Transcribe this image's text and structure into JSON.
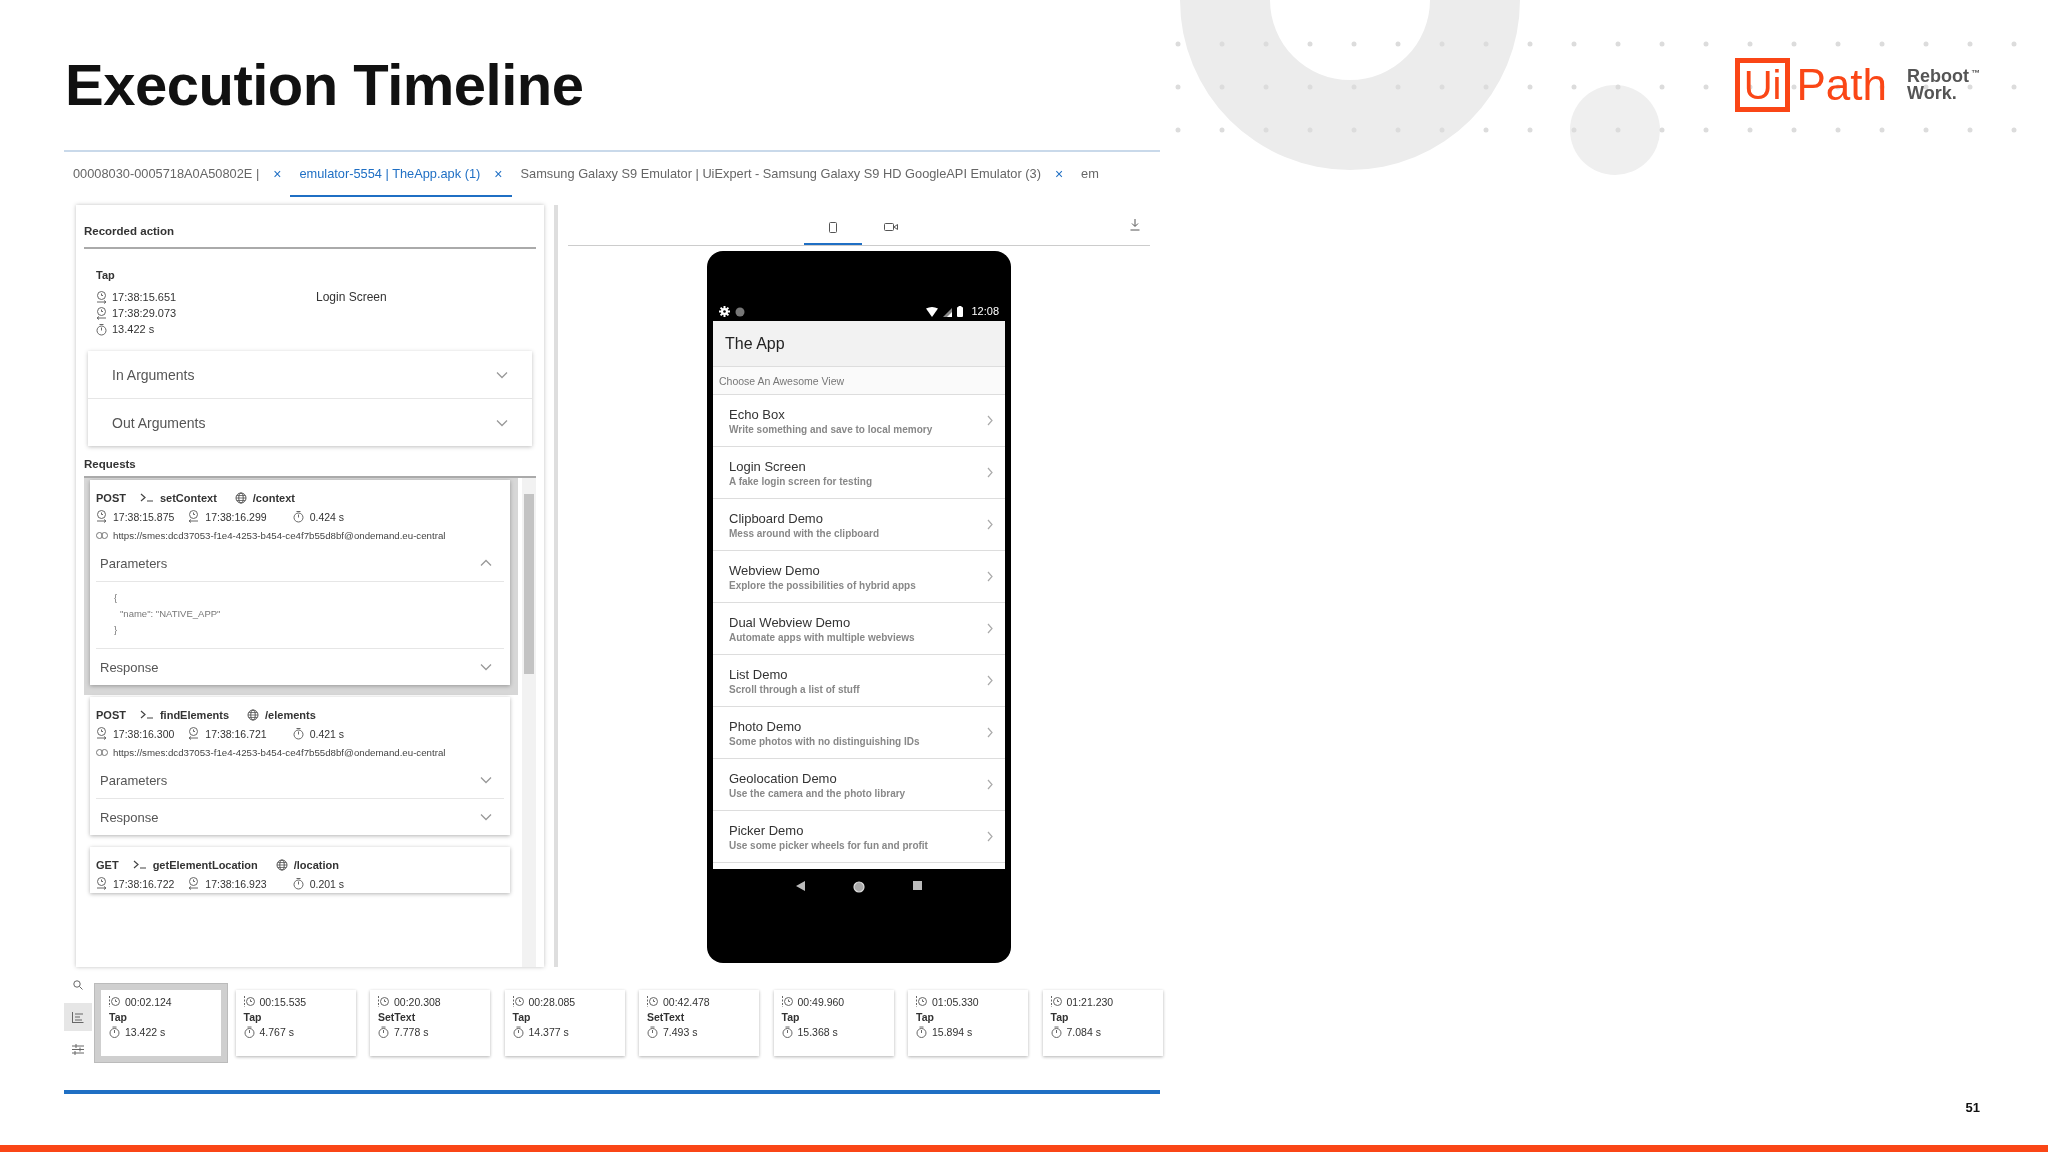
{
  "slide": {
    "title": "Execution Timeline",
    "page_number": "51",
    "logo": {
      "mark": "Ui",
      "name": "Path",
      "tagline": [
        "Reboot",
        "Work."
      ],
      "trademark": "™"
    }
  },
  "tabs": [
    {
      "label": "00008030-0005718A0A50802E |",
      "close": "×",
      "selected": false
    },
    {
      "label": "emulator-5554 | TheApp.apk (1)",
      "close": "×",
      "selected": true
    },
    {
      "label": "Samsung Galaxy S9 Emulator | UiExpert - Samsung Galaxy S9 HD GoogleAPI Emulator (3)",
      "close": "×",
      "selected": false
    },
    {
      "label": "em",
      "selected": false
    }
  ],
  "recorded_action": {
    "heading": "Recorded action",
    "action": "Tap",
    "start": "17:38:15.651",
    "end": "17:38:29.073",
    "duration": "13.422 s",
    "screen": "Login Screen",
    "sections": [
      {
        "label": "In Arguments",
        "expanded": false
      },
      {
        "label": "Out Arguments",
        "expanded": false
      }
    ]
  },
  "requests": {
    "heading": "Requests",
    "items": [
      {
        "method": "POST",
        "command": "setContext",
        "endpoint": "/context",
        "start": "17:38:15.875",
        "end": "17:38:16.299",
        "duration": "0.424 s",
        "url": "https://smes:dcd37053-f1e4-4253-b454-ce4f7b55d8bf@ondemand.eu-central",
        "selected": true,
        "sections": [
          {
            "label": "Parameters",
            "expanded": true,
            "body": [
              "{",
              "\"name\": \"NATIVE_APP\"",
              "}"
            ]
          },
          {
            "label": "Response",
            "expanded": false
          }
        ]
      },
      {
        "method": "POST",
        "command": "findElements",
        "endpoint": "/elements",
        "start": "17:38:16.300",
        "end": "17:38:16.721",
        "duration": "0.421 s",
        "url": "https://smes:dcd37053-f1e4-4253-b454-ce4f7b55d8bf@ondemand.eu-central",
        "selected": false,
        "sections": [
          {
            "label": "Parameters",
            "expanded": false
          },
          {
            "label": "Response",
            "expanded": false
          }
        ]
      },
      {
        "method": "GET",
        "command": "getElementLocation",
        "endpoint": "/location",
        "start": "17:38:16.722",
        "end": "17:38:16.923",
        "duration": "0.201 s",
        "selected": false
      }
    ]
  },
  "viewer": {
    "tabs": [
      {
        "kind": "device",
        "selected": true
      },
      {
        "kind": "video",
        "selected": false
      }
    ]
  },
  "phone": {
    "time": "12:08",
    "app_title": "The App",
    "section": "Choose An Awesome View",
    "items": [
      {
        "title": "Echo Box",
        "subtitle": "Write something and save to local memory"
      },
      {
        "title": "Login Screen",
        "subtitle": "A fake login screen for testing"
      },
      {
        "title": "Clipboard Demo",
        "subtitle": "Mess around with the clipboard"
      },
      {
        "title": "Webview Demo",
        "subtitle": "Explore the possibilities of hybrid apps"
      },
      {
        "title": "Dual Webview Demo",
        "subtitle": "Automate apps with multiple webviews"
      },
      {
        "title": "List Demo",
        "subtitle": "Scroll through a list of stuff"
      },
      {
        "title": "Photo Demo",
        "subtitle": "Some photos with no distinguishing IDs"
      },
      {
        "title": "Geolocation Demo",
        "subtitle": "Use the camera and the photo library"
      },
      {
        "title": "Picker Demo",
        "subtitle": "Use some picker wheels for fun and profit"
      }
    ]
  },
  "timeline": {
    "tools": [
      {
        "kind": "search",
        "selected": false
      },
      {
        "kind": "list",
        "selected": true
      },
      {
        "kind": "filter",
        "selected": false
      }
    ],
    "cards": [
      {
        "time": "00:02.124",
        "action": "Tap",
        "duration": "13.422 s",
        "selected": true
      },
      {
        "time": "00:15.535",
        "action": "Tap",
        "duration": "4.767 s",
        "selected": false
      },
      {
        "time": "00:20.308",
        "action": "SetText",
        "duration": "7.778 s",
        "selected": false
      },
      {
        "time": "00:28.085",
        "action": "Tap",
        "duration": "14.377 s",
        "selected": false
      },
      {
        "time": "00:42.478",
        "action": "SetText",
        "duration": "7.493 s",
        "selected": false
      },
      {
        "time": "00:49.960",
        "action": "Tap",
        "duration": "15.368 s",
        "selected": false
      },
      {
        "time": "01:05.330",
        "action": "Tap",
        "duration": "15.894 s",
        "selected": false
      },
      {
        "time": "01:21.230",
        "action": "Tap",
        "duration": "7.084 s",
        "selected": false
      }
    ]
  }
}
